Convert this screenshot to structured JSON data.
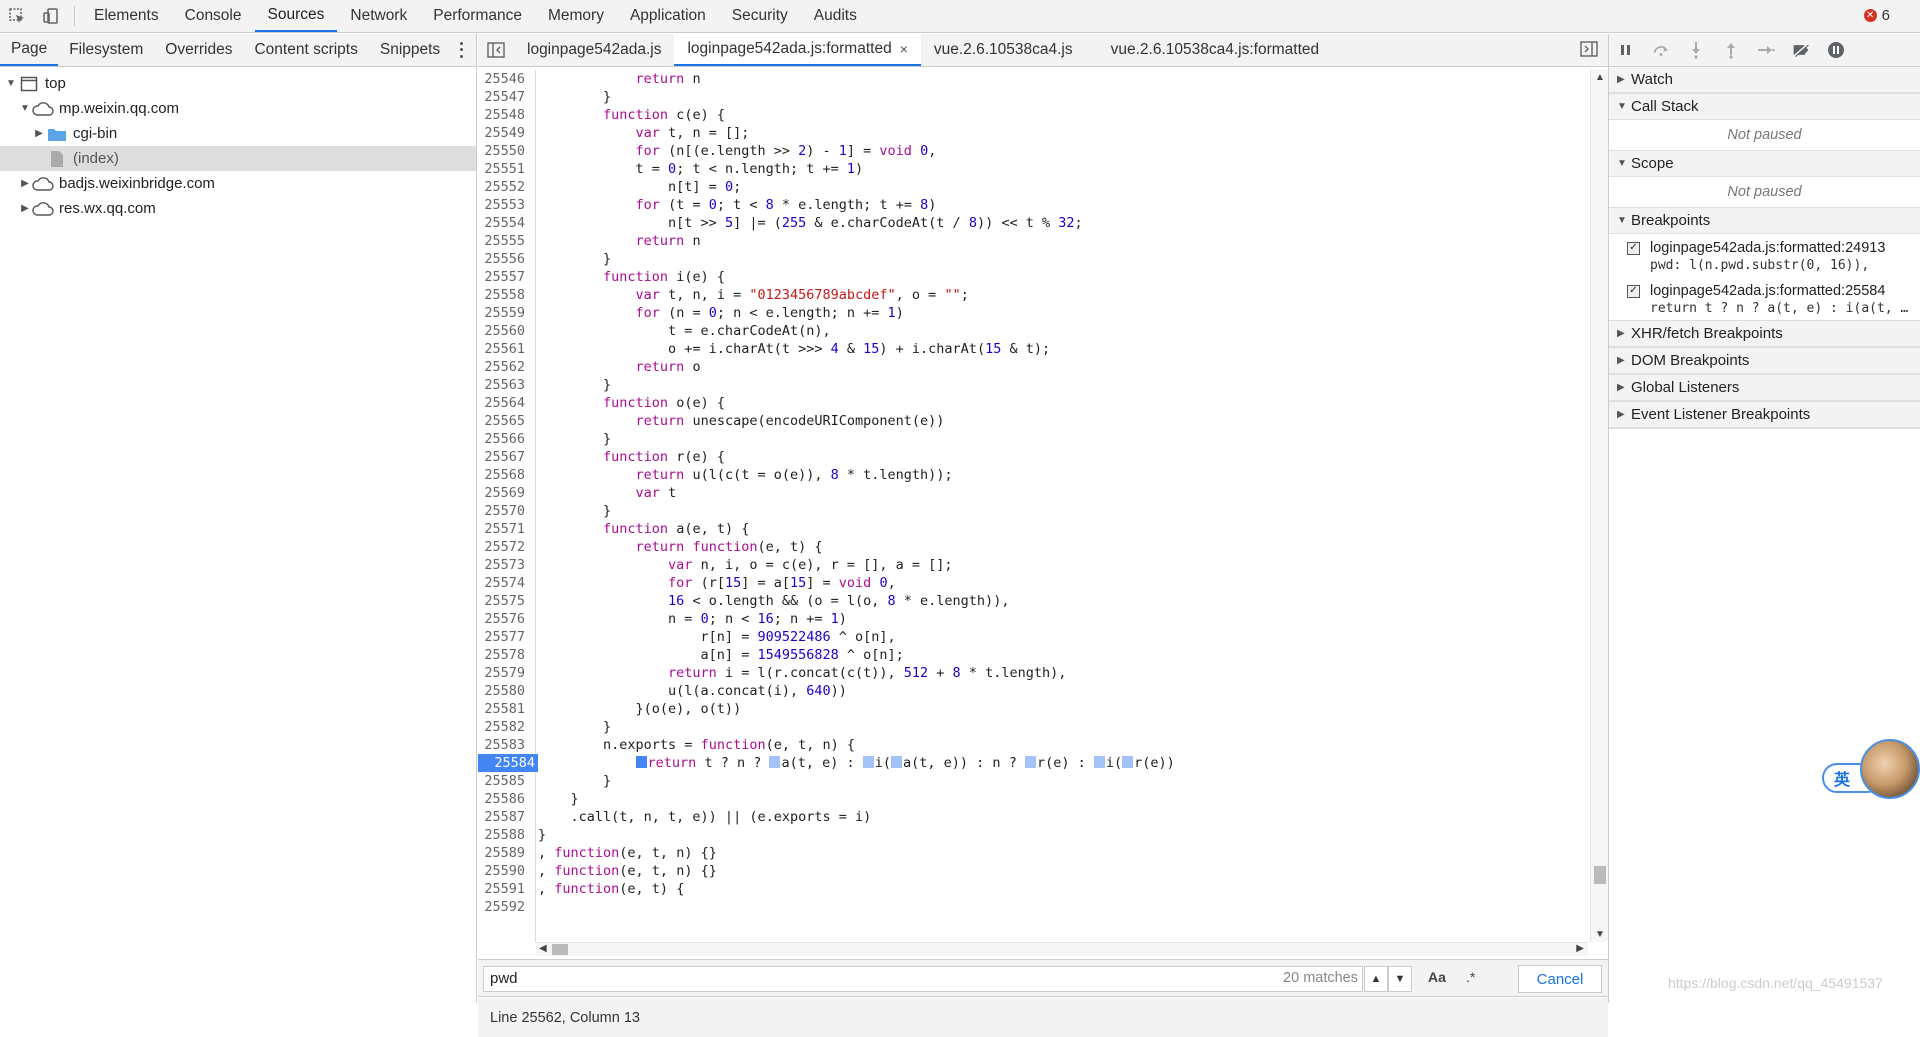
{
  "toolbar": {
    "tabs": [
      "Elements",
      "Console",
      "Sources",
      "Network",
      "Performance",
      "Memory",
      "Application",
      "Security",
      "Audits"
    ],
    "active_tab": "Sources",
    "error_count": "6"
  },
  "navigator": {
    "tabs": [
      "Page",
      "Filesystem",
      "Overrides",
      "Content scripts",
      "Snippets"
    ],
    "tree": {
      "top": "top",
      "domain1": "mp.weixin.qq.com",
      "folder": "cgi-bin",
      "file": "(index)",
      "domain2": "badjs.weixinbridge.com",
      "domain3": "res.wx.qq.com"
    }
  },
  "editor": {
    "tabs": [
      "loginpage542ada.js",
      "loginpage542ada.js:formatted",
      "vue.2.6.10538ca4.js",
      "vue.2.6.10538ca4.js:formatted"
    ],
    "tab_close": "×",
    "gutter": [
      "25546",
      "25547",
      "25548",
      "25549",
      "25550",
      "25551",
      "25552",
      "25553",
      "25554",
      "25555",
      "25556",
      "25557",
      "25558",
      "25559",
      "25560",
      "25561",
      "25562",
      "25563",
      "25564",
      "25565",
      "25566",
      "25567",
      "25568",
      "25569",
      "25570",
      "25571",
      "25572",
      "25573",
      "25574",
      "25575",
      "25576",
      "25577",
      "25578",
      "25579",
      "25580",
      "25581",
      "25582",
      "25583",
      "25584",
      "25585",
      "25586",
      "25587",
      "25588",
      "25589",
      "25590",
      "25591",
      "25592"
    ],
    "paused_line": "25584"
  },
  "search": {
    "query": "pwd",
    "matches": "20 matches",
    "case_label": "Aa",
    "regex_label": ".*",
    "cancel": "Cancel"
  },
  "status": {
    "position": "Line 25562, Column 13"
  },
  "debugger": {
    "watch": "Watch",
    "call_stack": "Call Stack",
    "call_stack_empty": "Not paused",
    "scope": "Scope",
    "scope_empty": "Not paused",
    "breakpoints": "Breakpoints",
    "bp_items": [
      {
        "location": "loginpage542ada.js:formatted:24913",
        "code": "pwd: l(n.pwd.substr(0, 16)),"
      },
      {
        "location": "loginpage542ada.js:formatted:25584",
        "code": "return t ? n ? a(t, e) : i(a(t, e)) : n ? r(e) : i(r(e))"
      }
    ],
    "xhr": "XHR/fetch Breakpoints",
    "dom": "DOM Breakpoints",
    "global": "Global Listeners",
    "event": "Event Listener Breakpoints"
  },
  "ime": {
    "label": "英"
  },
  "watermark": "https://blog.csdn.net/qq_45491537"
}
